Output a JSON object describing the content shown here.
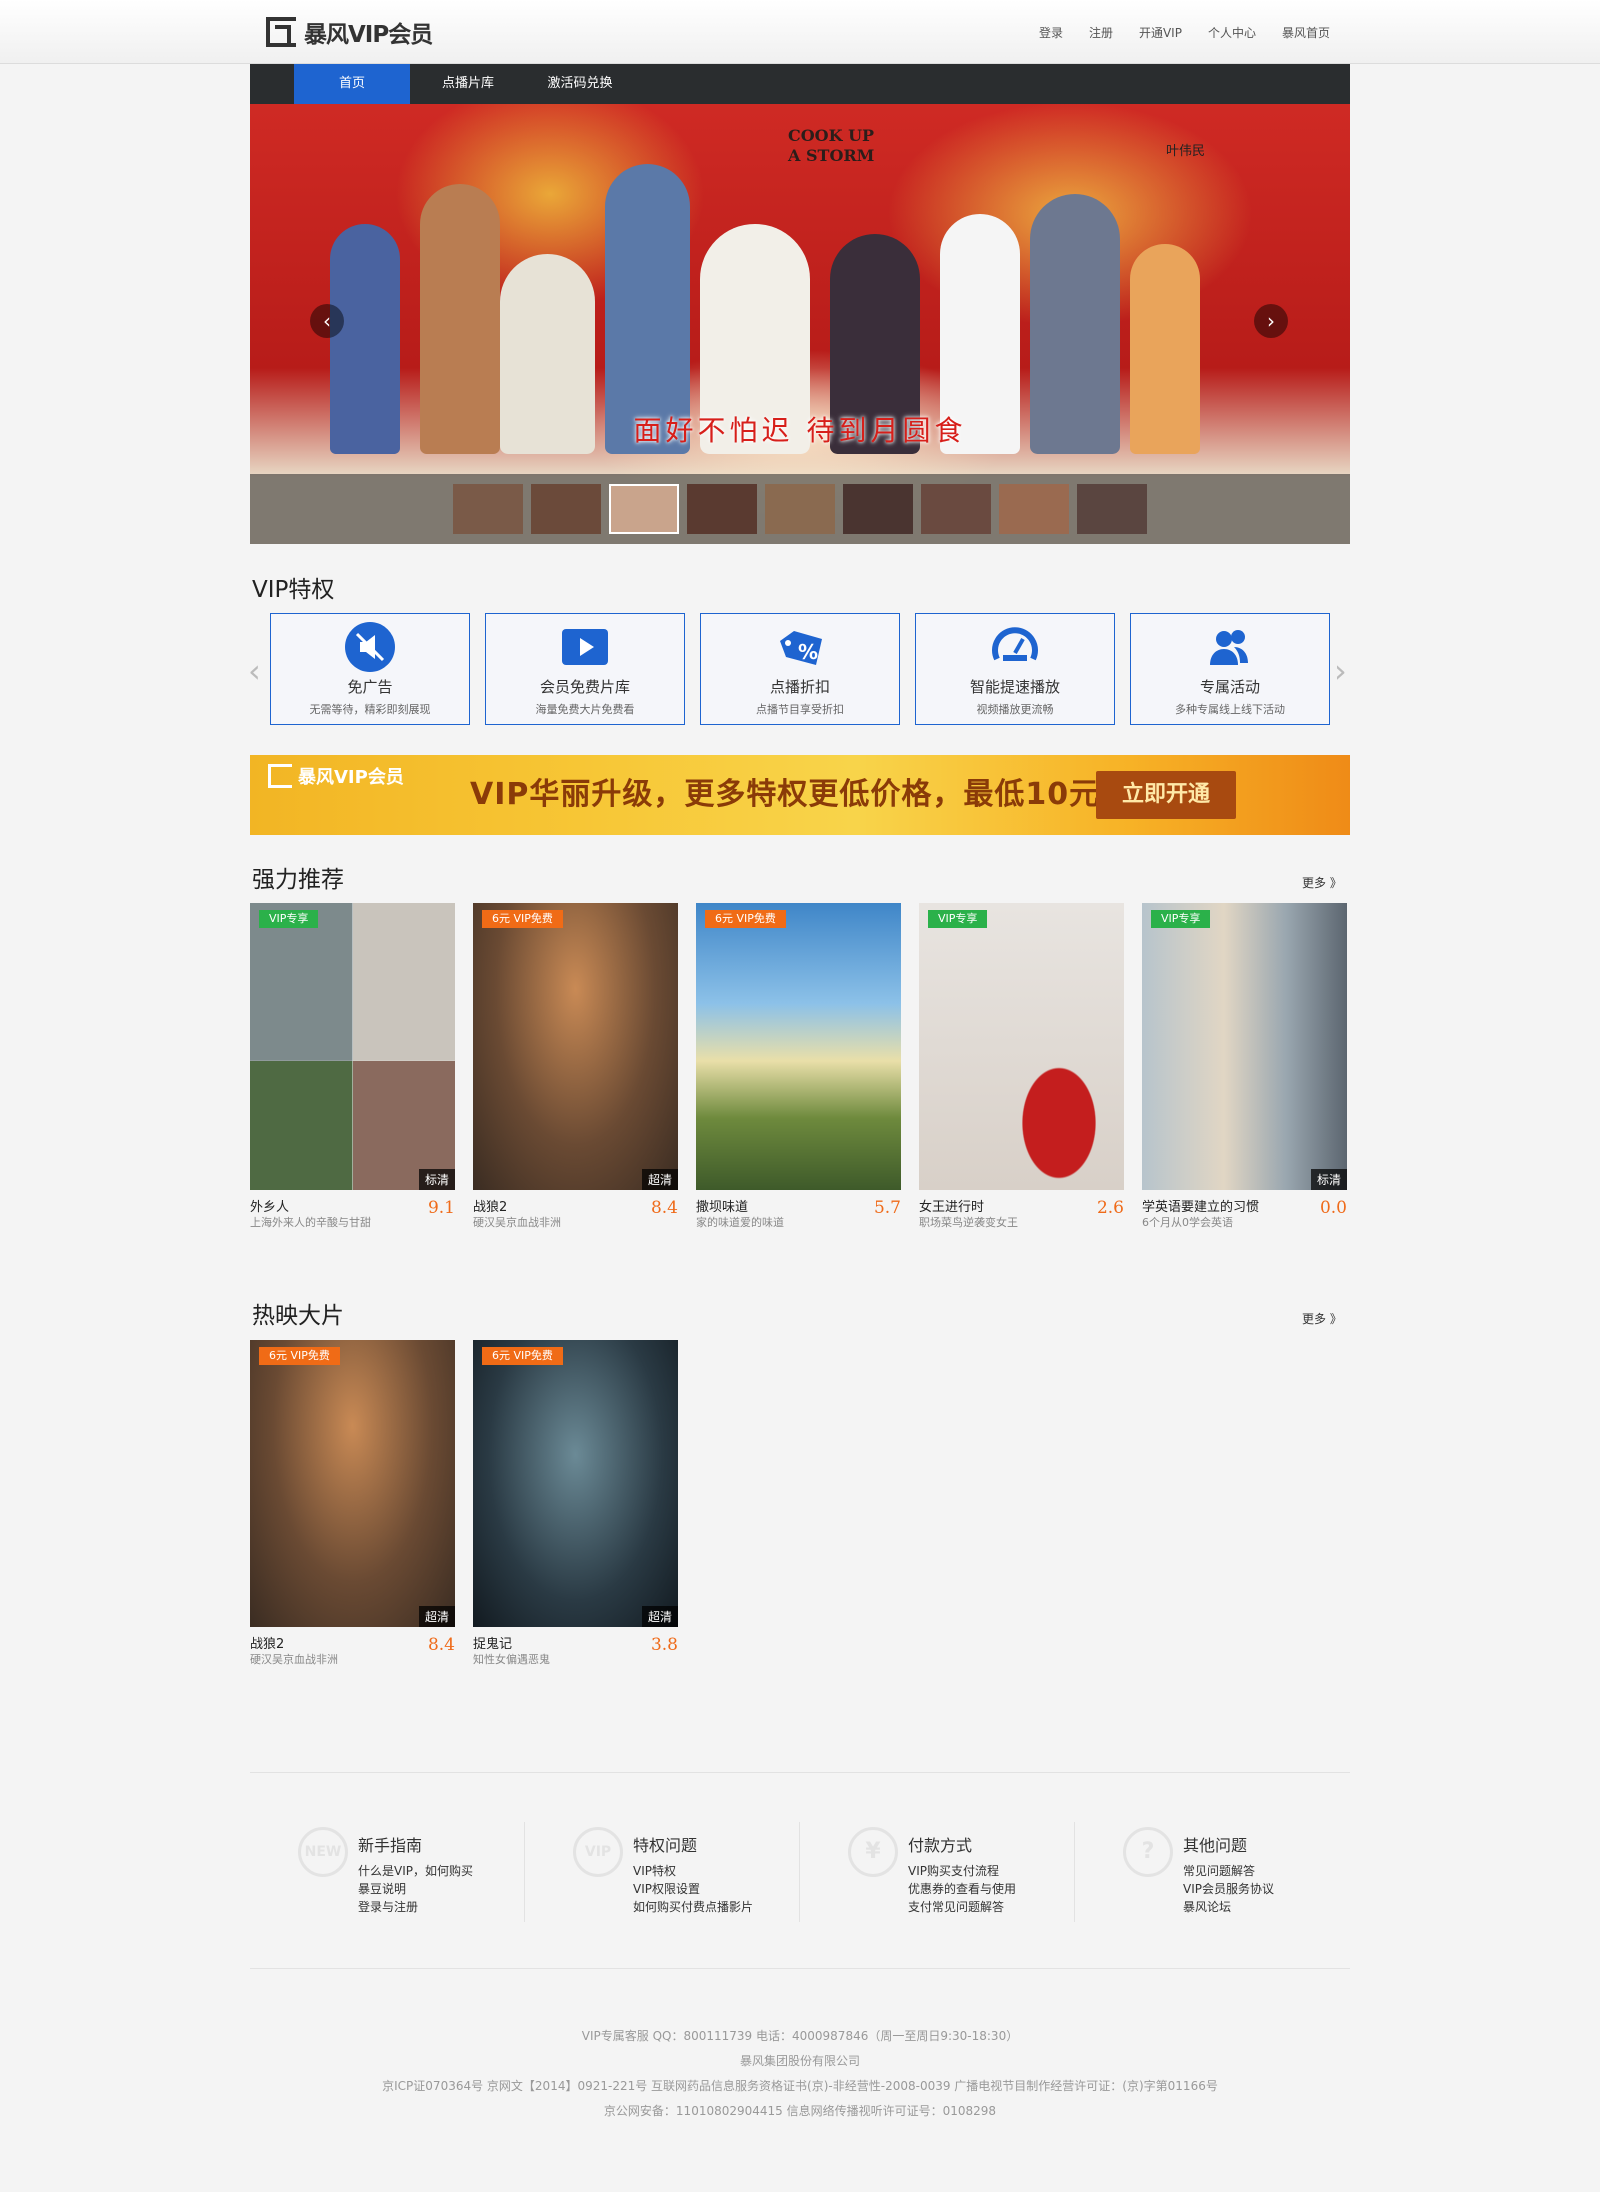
{
  "header": {
    "logo_text": "暴风VIP会员",
    "links": [
      "登录",
      "注册",
      "开通VIP",
      "个人中心",
      "暴风首页"
    ]
  },
  "nav": {
    "items": [
      "首页",
      "点播片库",
      "激活码兑换"
    ]
  },
  "hero": {
    "title": "面好不怕迟  待到月圆食",
    "english_title": "COOK UP\nA STORM",
    "credit": "叶伟民",
    "prev_icon": "chevron-left-icon",
    "next_icon": "chevron-right-icon"
  },
  "vip_privileges": {
    "heading": "VIP特权",
    "items": [
      {
        "title": "免广告",
        "desc": "无需等待，精彩即刻展现",
        "icon": "no-ads-icon"
      },
      {
        "title": "会员免费片库",
        "desc": "海量免费大片免费看",
        "icon": "play-icon"
      },
      {
        "title": "点播折扣",
        "desc": "点播节目享受折扣",
        "icon": "discount-tag-icon"
      },
      {
        "title": "智能提速播放",
        "desc": "视频播放更流畅",
        "icon": "speedometer-icon"
      },
      {
        "title": "专属活动",
        "desc": "多种专属线上线下活动",
        "icon": "users-icon"
      }
    ]
  },
  "promo": {
    "logo_text": "暴风VIP会员",
    "text": "VIP华丽升级，更多特权更低价格，最低10元/月起！",
    "button": "立即开通"
  },
  "recommended": {
    "heading": "强力推荐",
    "more": "更多 》",
    "items": [
      {
        "title": "外乡人",
        "desc": "上海外来人的辛酸与甘甜",
        "score": "9.1",
        "badge": "VIP专享",
        "quality": "标清"
      },
      {
        "title": "战狼2",
        "desc": "硬汉吴京血战非洲",
        "score": "8.4",
        "badge": "6元 VIP免费",
        "quality": "超清"
      },
      {
        "title": "撒坝味道",
        "desc": "家的味道爱的味道",
        "score": "5.7",
        "badge": "6元 VIP免费",
        "quality": ""
      },
      {
        "title": "女王进行时",
        "desc": "职场菜鸟逆袭变女王",
        "score": "2.6",
        "badge": "VIP专享",
        "quality": ""
      },
      {
        "title": "学英语要建立的习惯",
        "desc": "6个月从0学会英语",
        "score": "0.0",
        "badge": "VIP专享",
        "quality": "标清"
      }
    ]
  },
  "hot": {
    "heading": "热映大片",
    "more": "更多 》",
    "items": [
      {
        "title": "战狼2",
        "desc": "硬汉吴京血战非洲",
        "score": "8.4",
        "badge": "6元 VIP免费",
        "quality": "超清"
      },
      {
        "title": "捉鬼记",
        "desc": "知性女偏遇恶鬼",
        "score": "3.8",
        "badge": "6元 VIP免费",
        "quality": "超清"
      }
    ]
  },
  "help": [
    {
      "title": "新手指南",
      "icon_text": "NEW",
      "links": [
        "什么是VIP，如何购买",
        "暴豆说明",
        "登录与注册"
      ]
    },
    {
      "title": "特权问题",
      "icon_text": "VIP",
      "links": [
        "VIP特权",
        "VIP权限设置",
        "如何购买付费点播影片"
      ]
    },
    {
      "title": "付款方式",
      "icon_text": "¥",
      "links": [
        "VIP购买支付流程",
        "优惠券的查看与使用",
        "支付常见问题解答"
      ]
    },
    {
      "title": "其他问题",
      "icon_text": "?",
      "links": [
        "常见问题解答",
        "VIP会员服务协议",
        "暴风论坛"
      ]
    }
  ],
  "footer": {
    "lines": [
      "VIP专属客服 QQ：800111739 电话：4000987846（周一至周日9:30-18:30）",
      "暴风集团股份有限公司",
      "京ICP证070364号  京网文【2014】0921-221号  互联网药品信息服务资格证书(京)-非经营性-2008-0039  广播电视节目制作经营许可证：(京)字第01166号",
      "京公网安备：11010802904415  信息网络传播视听许可证号：0108298"
    ]
  }
}
